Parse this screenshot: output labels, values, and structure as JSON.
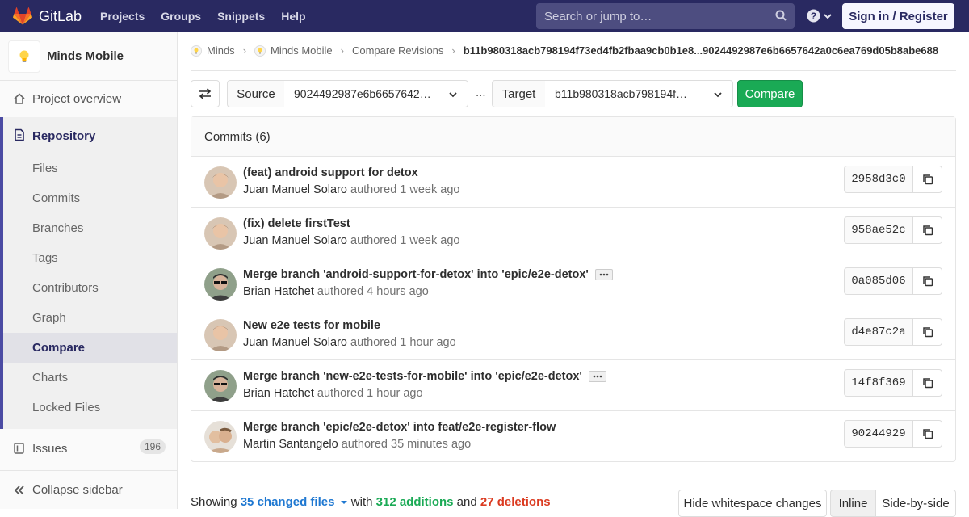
{
  "navbar": {
    "brand": "GitLab",
    "links": [
      "Projects",
      "Groups",
      "Snippets",
      "Help"
    ],
    "search_placeholder": "Search or jump to…",
    "signin": "Sign in / Register",
    "bg_color": "#292961"
  },
  "sidebar": {
    "project_name": "Minds Mobile",
    "overview": "Project overview",
    "repository": "Repository",
    "repo_items": [
      "Files",
      "Commits",
      "Branches",
      "Tags",
      "Contributors",
      "Graph",
      "Compare",
      "Charts",
      "Locked Files"
    ],
    "active_item": "Compare",
    "issues": "Issues",
    "issues_count": "196",
    "collapse": "Collapse sidebar"
  },
  "breadcrumb": {
    "items": [
      "Minds",
      "Minds Mobile",
      "Compare Revisions"
    ],
    "current": "b11b980318acb798194f73ed4fb2fbaa9cb0b1e8...9024492987e6b6657642a0c6ea769d05b8abe688"
  },
  "compare": {
    "source_label": "Source",
    "source_value": "9024492987e6b6657642…",
    "separator": "...",
    "target_label": "Target",
    "target_value": "b11b980318acb798194f…",
    "compare_button": "Compare"
  },
  "commits": {
    "header": "Commits (6)",
    "authored_word": "authored",
    "items": [
      {
        "title": "(feat) android support for detox",
        "author": "Juan Manuel Solaro",
        "time": "1 week ago",
        "sha": "2958d3c0",
        "has_more": false,
        "avatar": "juan"
      },
      {
        "title": "(fix) delete firstTest",
        "author": "Juan Manuel Solaro",
        "time": "1 week ago",
        "sha": "958ae52c",
        "has_more": false,
        "avatar": "juan"
      },
      {
        "title": "Merge branch 'android-support-for-detox' into 'epic/e2e-detox'",
        "author": "Brian Hatchet",
        "time": "4 hours ago",
        "sha": "0a085d06",
        "has_more": true,
        "avatar": "brian"
      },
      {
        "title": "New e2e tests for mobile",
        "author": "Juan Manuel Solaro",
        "time": "1 hour ago",
        "sha": "d4e87c2a",
        "has_more": false,
        "avatar": "juan"
      },
      {
        "title": "Merge branch 'new-e2e-tests-for-mobile' into 'epic/e2e-detox'",
        "author": "Brian Hatchet",
        "time": "1 hour ago",
        "sha": "14f8f369",
        "has_more": true,
        "avatar": "brian"
      },
      {
        "title": "Merge branch 'epic/e2e-detox' into feat/e2e-register-flow",
        "author": "Martin Santangelo",
        "time": "35 minutes ago",
        "sha": "90244929",
        "has_more": false,
        "avatar": "martin"
      }
    ]
  },
  "summary": {
    "showing": "Showing",
    "changed_files": "35 changed files",
    "with": "with",
    "additions": "312 additions",
    "and": "and",
    "deletions": "27 deletions",
    "hide_whitespace": "Hide whitespace changes",
    "inline": "Inline",
    "side_by_side": "Side-by-side"
  }
}
